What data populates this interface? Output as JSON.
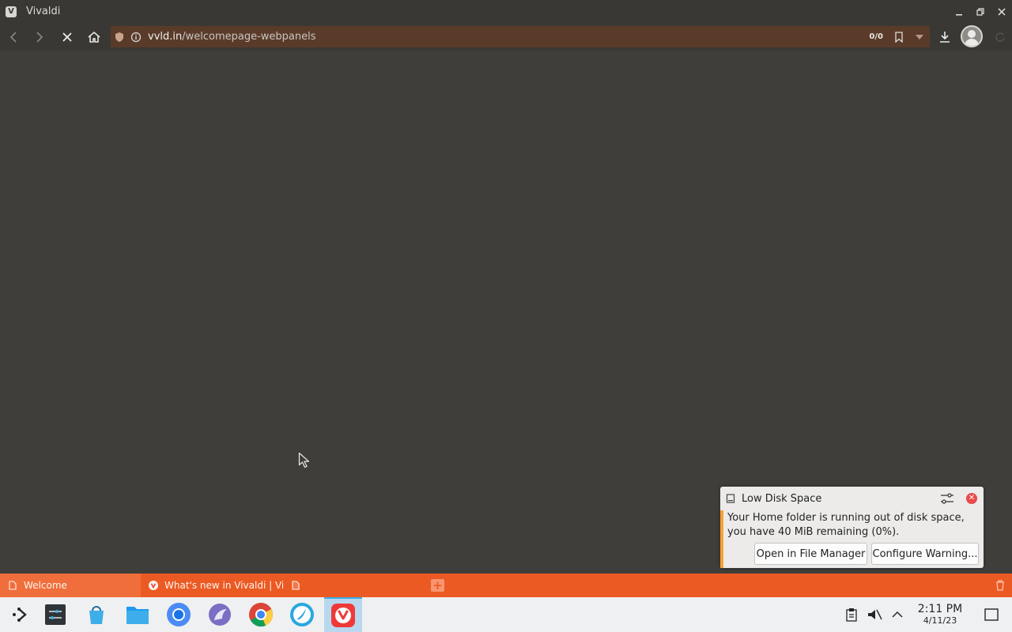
{
  "window": {
    "title": "Vivaldi"
  },
  "toolbar": {
    "url_host": "vvld.in",
    "url_path": "/welcomepage-webpanels",
    "blocker_count": "0/0"
  },
  "notification": {
    "title": "Low Disk Space",
    "body_line1": "Your Home folder is running out of disk space,",
    "body_line2": "you have 40 MiB remaining (0%).",
    "open_button": "Open in File Manager",
    "configure_button": "Configure Warning...",
    "accent_color": "#f6a039"
  },
  "tabs": [
    {
      "label": "Welcome",
      "icon": "document-icon",
      "active": true
    },
    {
      "label": "What's new in Vivaldi | Vi",
      "icon": "vivaldi-icon",
      "active": false
    },
    {
      "label": "",
      "icon": "document-icon",
      "active": false
    }
  ],
  "taskbar": {
    "apps": [
      "application-launcher-icon",
      "system-settings-icon",
      "discover-store-icon",
      "file-manager-icon",
      "chromium-icon",
      "web-browser-icon",
      "chrome-icon",
      "falkon-browser-icon",
      "vivaldi-icon"
    ],
    "clock_time": "2:11 PM",
    "clock_date": "4/11/23"
  },
  "colors": {
    "tabbar": "#ec5a24",
    "vivaldi_red": "#ef3939"
  }
}
